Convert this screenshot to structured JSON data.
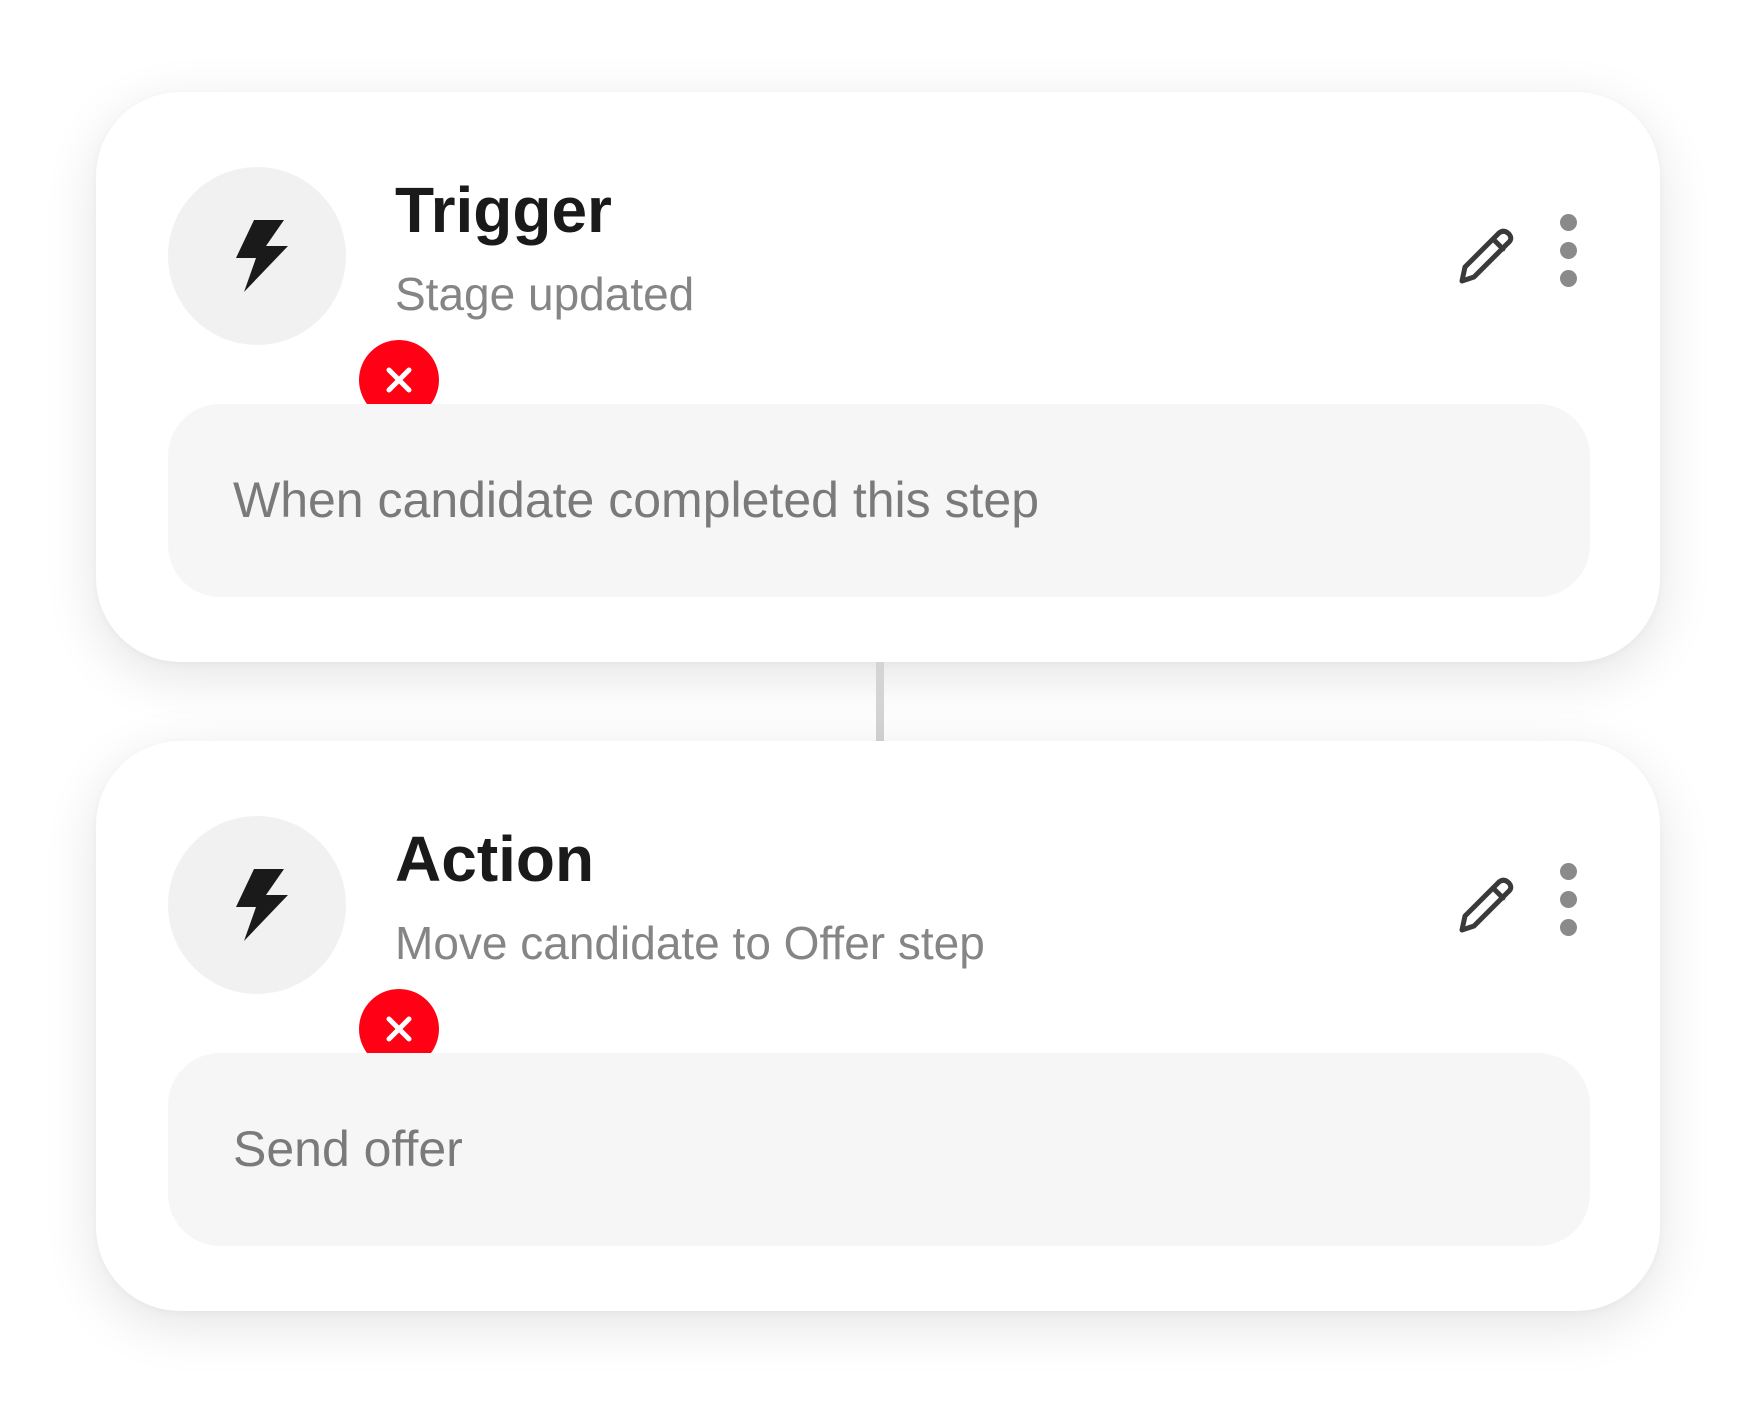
{
  "colors": {
    "error_badge": "#ff0014",
    "icon_background": "#f1f1f1",
    "detail_background": "#f6f6f6",
    "connector": "#d4d4d4"
  },
  "steps": [
    {
      "title": "Trigger",
      "subtitle": "Stage updated",
      "detail": "When candidate completed this step",
      "icon": "lightning-bolt-icon",
      "status_icon": "error-x-icon"
    },
    {
      "title": "Action",
      "subtitle": "Move candidate to Offer step",
      "detail": "Send offer",
      "icon": "lightning-bolt-icon",
      "status_icon": "error-x-icon"
    }
  ],
  "actions": {
    "edit_icon": "pencil-icon",
    "more_icon": "more-vertical-icon"
  }
}
